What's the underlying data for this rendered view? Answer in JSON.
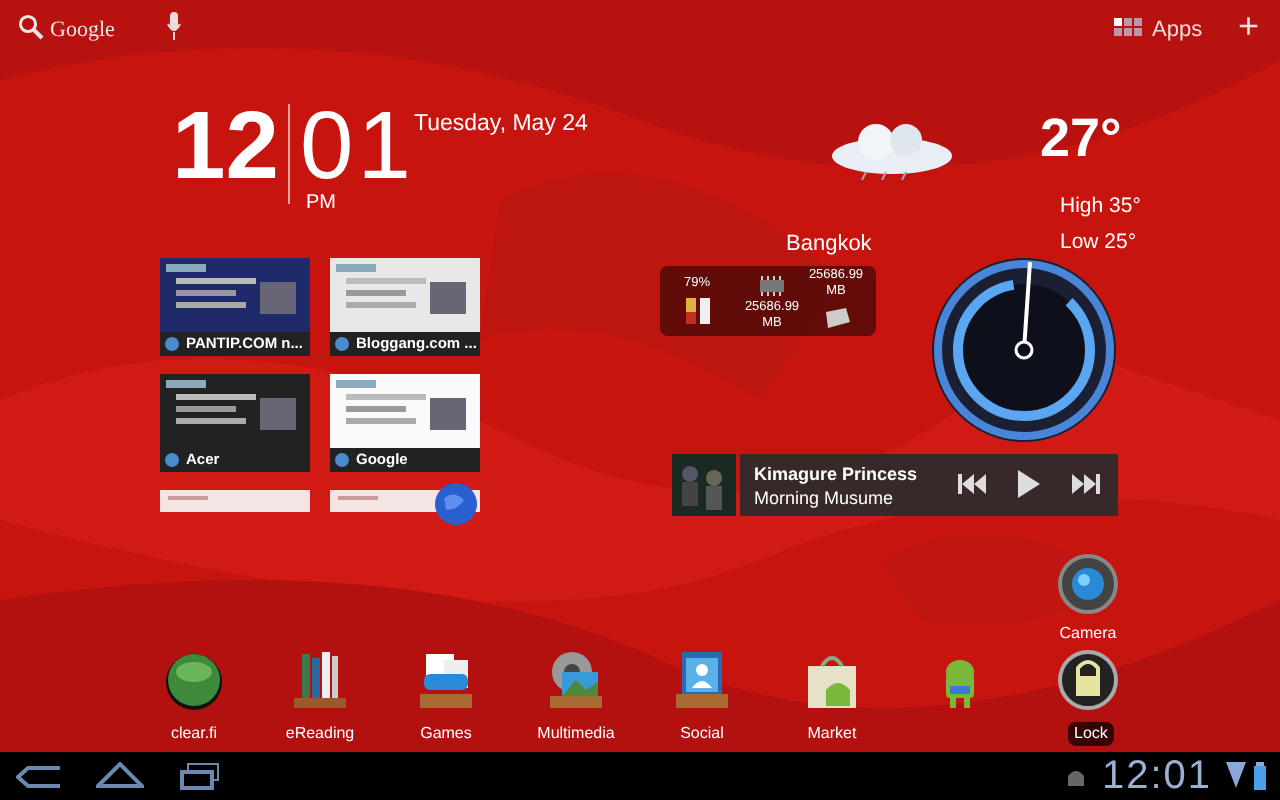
{
  "search_bar": {
    "label": "Google"
  },
  "top_actions": {
    "apps_label": "Apps",
    "add_label": "+"
  },
  "clock": {
    "hour": "12",
    "minute": "01",
    "ampm": "PM",
    "date": "Tuesday, May 24"
  },
  "weather": {
    "temperature": "27°",
    "high": "High 35°",
    "low": "Low 25°",
    "city": "Bangkok"
  },
  "system_widget": {
    "battery": "79%",
    "memory": "25686.99 MB",
    "storage": "25686.99 MB"
  },
  "bookmarks": [
    {
      "title": "PANTIP.COM n..."
    },
    {
      "title": "Bloggang.com ..."
    },
    {
      "title": "Acer"
    },
    {
      "title": "Google"
    }
  ],
  "music": {
    "title": "Kimagure Princess",
    "artist": "Morning Musume"
  },
  "dock": [
    {
      "kind": "clearfi",
      "label": "clear.fi"
    },
    {
      "kind": "books",
      "label": "eReading"
    },
    {
      "kind": "games",
      "label": "Games"
    },
    {
      "kind": "media",
      "label": "Multimedia"
    },
    {
      "kind": "social",
      "label": "Social"
    },
    {
      "kind": "market",
      "label": "Market"
    },
    {
      "kind": "android"
    },
    {
      "kind": "lock",
      "label": "Lock"
    }
  ],
  "camera": {
    "label": "Camera"
  },
  "status_bar": {
    "time": "12:01"
  }
}
